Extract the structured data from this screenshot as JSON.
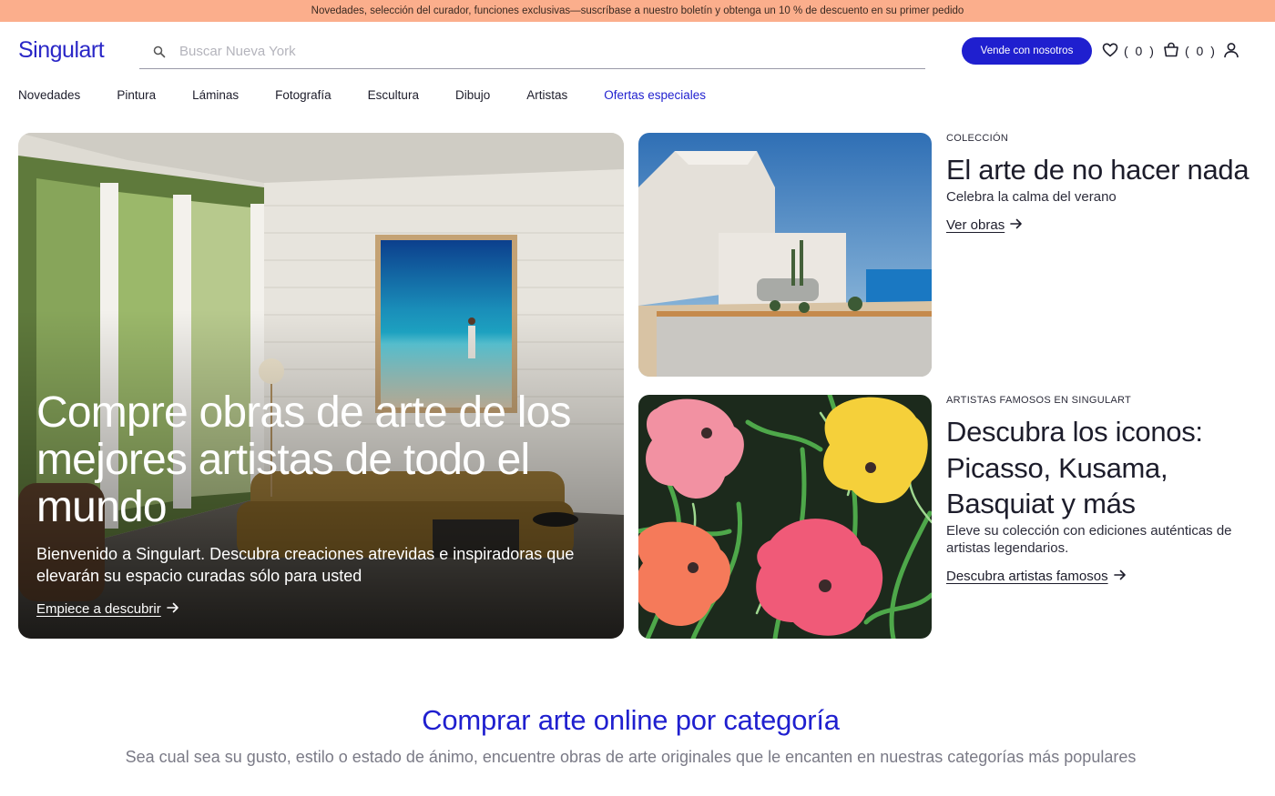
{
  "promo": {
    "text": "Novedades, selección del curador, funciones exclusivas—suscríbase a nuestro boletín y obtenga un 10 % de descuento en su primer pedido",
    "bg_color": "#fbae8c"
  },
  "header": {
    "logo": "Singulart",
    "search_placeholder": "Buscar Nueva York",
    "sell_label": "Vende con nosotros",
    "wishlist_count": "( 0 )",
    "cart_count": "( 0 )",
    "icons": [
      "search-icon",
      "heart-icon",
      "bag-icon",
      "user-icon"
    ],
    "accent_color": "#1f1fcf"
  },
  "nav": {
    "items": [
      "Novedades",
      "Pintura",
      "Láminas",
      "Fotografía",
      "Escultura",
      "Dibujo",
      "Artistas"
    ],
    "special": "Ofertas especiales"
  },
  "hero": {
    "title": "Compre obras de arte de los mejores artistas de todo el mundo",
    "subtitle": "Bienvenido a Singulart. Descubra creaciones atrevidas e inspiradoras que elevarán su espacio curadas sólo para usted",
    "link": "Empiece a descubrir"
  },
  "cards": [
    {
      "eyebrow": "COLECCIÓN",
      "title": "El arte de no hacer nada",
      "description": "Celebra la calma del verano",
      "link": "Ver obras"
    },
    {
      "eyebrow": "ARTISTAS FAMOSOS EN SINGULART",
      "title": "Descubra los iconos: Picasso, Kusama, Basquiat y más",
      "description": "Eleve su colección con ediciones auténticas de artistas legendarios.",
      "link": "Descubra artistas famosos"
    }
  ],
  "category_section": {
    "title": "Comprar arte online por categoría",
    "subtitle": "Sea cual sea su gusto, estilo o estado de ánimo, encuentre obras de arte originales que le encanten en nuestras categorías más populares"
  }
}
